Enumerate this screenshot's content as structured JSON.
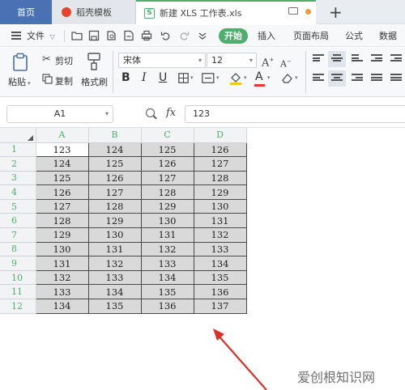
{
  "tabs": {
    "home": "首页",
    "template": "稻壳模板",
    "file": "新建 XLS 工作表.xls"
  },
  "menu": {
    "file": "文件",
    "start": "开始",
    "insert": "插入",
    "layout": "页面布局",
    "formula": "公式",
    "data": "数据"
  },
  "ribbon": {
    "paste": "粘贴",
    "cut": "剪切",
    "copy": "复制",
    "format_painter": "格式刷",
    "font_name": "宋体",
    "font_size": "12"
  },
  "formula_bar": {
    "cell_ref": "A1",
    "fx": "fx",
    "value": "123"
  },
  "sheet": {
    "columns": [
      "A",
      "B",
      "C",
      "D"
    ],
    "rows": [
      {
        "num": "1",
        "cells": [
          "123",
          "124",
          "125",
          "126"
        ]
      },
      {
        "num": "2",
        "cells": [
          "124",
          "125",
          "126",
          "127"
        ]
      },
      {
        "num": "3",
        "cells": [
          "125",
          "126",
          "127",
          "128"
        ]
      },
      {
        "num": "4",
        "cells": [
          "126",
          "127",
          "128",
          "129"
        ]
      },
      {
        "num": "5",
        "cells": [
          "127",
          "128",
          "129",
          "130"
        ]
      },
      {
        "num": "6",
        "cells": [
          "128",
          "129",
          "130",
          "131"
        ]
      },
      {
        "num": "7",
        "cells": [
          "129",
          "130",
          "131",
          "132"
        ]
      },
      {
        "num": "8",
        "cells": [
          "130",
          "131",
          "132",
          "133"
        ]
      },
      {
        "num": "9",
        "cells": [
          "131",
          "132",
          "133",
          "134"
        ]
      },
      {
        "num": "10",
        "cells": [
          "132",
          "133",
          "134",
          "135"
        ]
      },
      {
        "num": "11",
        "cells": [
          "133",
          "134",
          "135",
          "136"
        ]
      },
      {
        "num": "12",
        "cells": [
          "134",
          "135",
          "136",
          "137"
        ]
      }
    ]
  },
  "watermark": "爱创根知识网",
  "colors": {
    "home_tab": "#4b71b5",
    "accent_green": "#4fae6c",
    "arrow_red": "#d9312b",
    "selected_cells": "#d9d9d9"
  }
}
